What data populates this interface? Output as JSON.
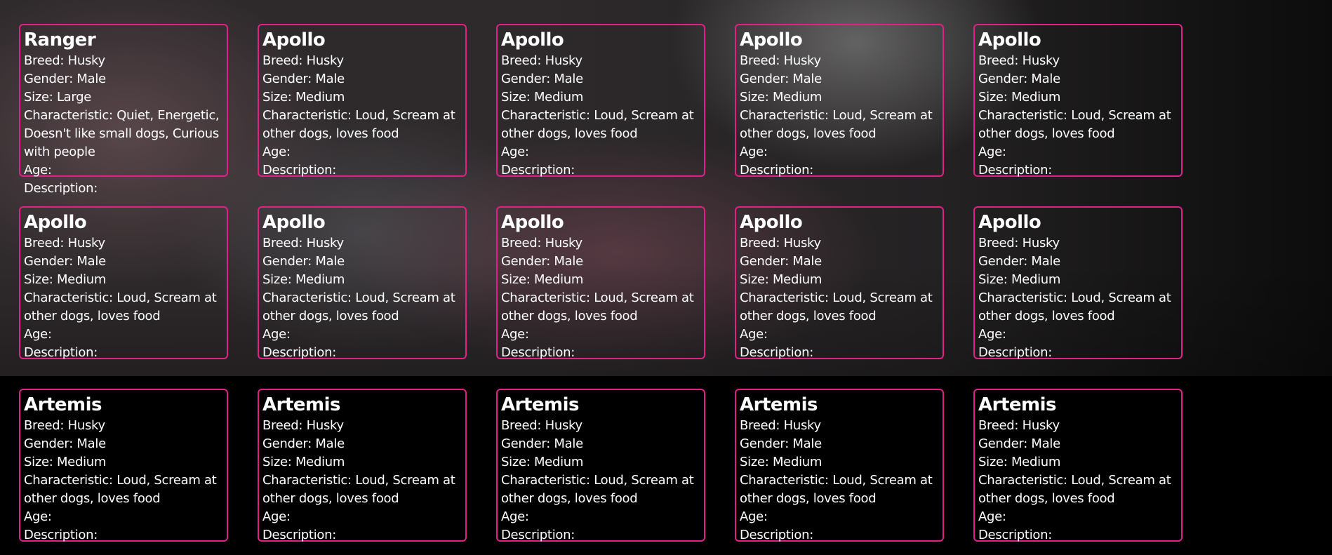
{
  "accent_color": "#e0218a",
  "labels": {
    "breed": "Breed: ",
    "gender": "Gender: ",
    "size": "Size: ",
    "characteristic": "Characteristic: ",
    "age": "Age:",
    "description": "Description:"
  },
  "cards": [
    {
      "name": "Ranger",
      "breed": "Husky",
      "gender": "Male",
      "size": "Large",
      "characteristic": "Quiet, Energetic, Doesn't like small dogs, Curious with people"
    },
    {
      "name": "Apollo",
      "breed": "Husky",
      "gender": "Male",
      "size": "Medium",
      "characteristic": "Loud, Scream at other dogs, loves food"
    },
    {
      "name": "Apollo",
      "breed": "Husky",
      "gender": "Male",
      "size": "Medium",
      "characteristic": "Loud, Scream at other dogs, loves food"
    },
    {
      "name": "Apollo",
      "breed": "Husky",
      "gender": "Male",
      "size": "Medium",
      "characteristic": "Loud, Scream at other dogs, loves food"
    },
    {
      "name": "Apollo",
      "breed": "Husky",
      "gender": "Male",
      "size": "Medium",
      "characteristic": "Loud, Scream at other dogs, loves food"
    },
    {
      "name": "Apollo",
      "breed": "Husky",
      "gender": "Male",
      "size": "Medium",
      "characteristic": "Loud, Scream at other dogs, loves food"
    },
    {
      "name": "Apollo",
      "breed": "Husky",
      "gender": "Male",
      "size": "Medium",
      "characteristic": "Loud, Scream at other dogs, loves food"
    },
    {
      "name": "Apollo",
      "breed": "Husky",
      "gender": "Male",
      "size": "Medium",
      "characteristic": "Loud, Scream at other dogs, loves food"
    },
    {
      "name": "Apollo",
      "breed": "Husky",
      "gender": "Male",
      "size": "Medium",
      "characteristic": "Loud, Scream at other dogs, loves food"
    },
    {
      "name": "Apollo",
      "breed": "Husky",
      "gender": "Male",
      "size": "Medium",
      "characteristic": "Loud, Scream at other dogs, loves food"
    },
    {
      "name": "Artemis",
      "breed": "Husky",
      "gender": "Male",
      "size": "Medium",
      "characteristic": "Loud, Scream at other dogs, loves food"
    },
    {
      "name": "Artemis",
      "breed": "Husky",
      "gender": "Male",
      "size": "Medium",
      "characteristic": "Loud, Scream at other dogs, loves food"
    },
    {
      "name": "Artemis",
      "breed": "Husky",
      "gender": "Male",
      "size": "Medium",
      "characteristic": "Loud, Scream at other dogs, loves food"
    },
    {
      "name": "Artemis",
      "breed": "Husky",
      "gender": "Male",
      "size": "Medium",
      "characteristic": "Loud, Scream at other dogs, loves food"
    },
    {
      "name": "Artemis",
      "breed": "Husky",
      "gender": "Male",
      "size": "Medium",
      "characteristic": "Loud, Scream at other dogs, loves food"
    }
  ]
}
